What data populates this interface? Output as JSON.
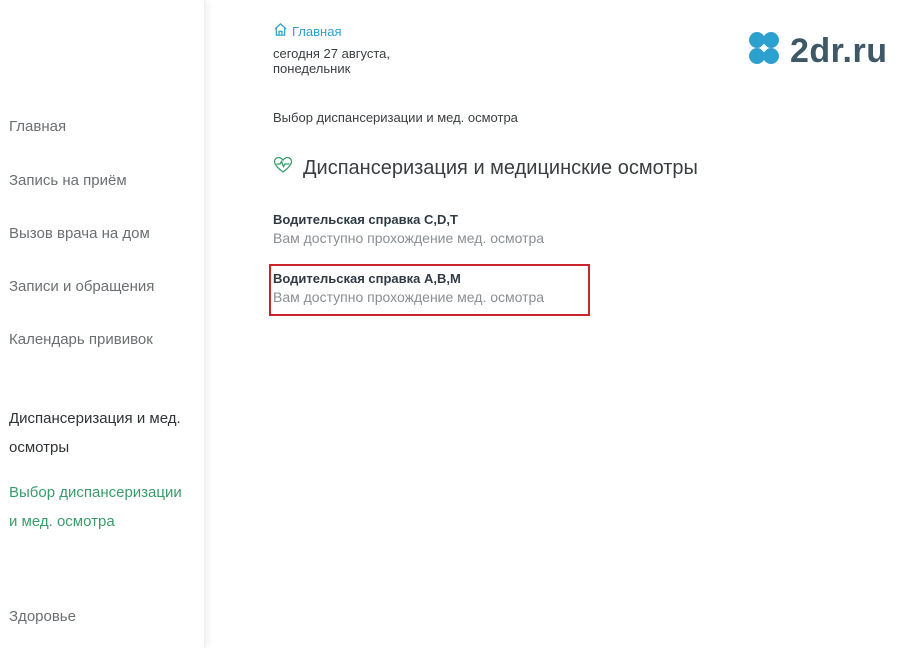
{
  "sidebar": {
    "items": [
      {
        "label": "Главная"
      },
      {
        "label": "Запись на приём"
      },
      {
        "label": "Вызов врача на дом"
      },
      {
        "label": "Записи и обращения"
      },
      {
        "label": "Календарь прививок"
      }
    ],
    "section": {
      "label": "Диспансеризация и мед. осмотры"
    },
    "active": {
      "label": "Выбор диспансеризации и мед. осмотра"
    },
    "bottom": {
      "label": "Здоровье"
    }
  },
  "header": {
    "home_link": "Главная",
    "date_line1": "сегодня 27 августа,",
    "date_line2": "понедельник",
    "logo_text": "2dr.ru"
  },
  "main": {
    "breadcrumb": "Выбор диспансеризации и мед. осмотра",
    "title": "Диспансеризация и медицинские осмотры",
    "cards": [
      {
        "title": "Водительская справка C,D,T",
        "subtitle": "Вам доступно прохождение мед. осмотра"
      },
      {
        "title": "Водительская справка A,B,M",
        "subtitle": "Вам доступно прохождение мед. осмотра"
      }
    ]
  },
  "colors": {
    "accent": "#3a9c6a",
    "link": "#2ea0d0",
    "logo": "#3e5867",
    "logo_mark": "#2ea0d0",
    "highlight": "#c6262c"
  },
  "icons": {
    "home": "home-icon",
    "heart_pulse": "heart-pulse-icon",
    "logo_mark": "clover-logo-icon"
  }
}
